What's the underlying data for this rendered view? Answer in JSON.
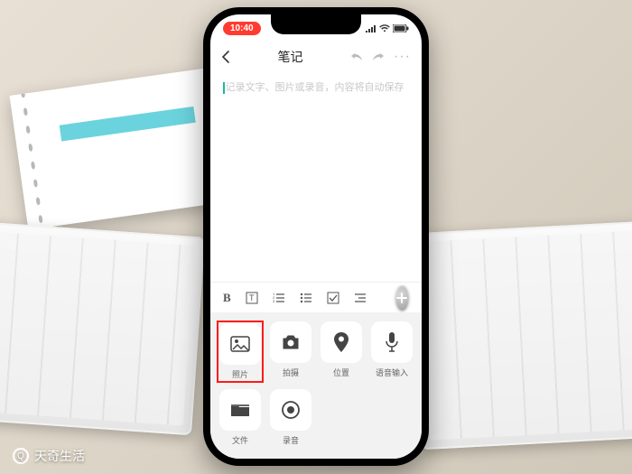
{
  "status": {
    "time": "10:40",
    "signal_icon": "signal-icon",
    "wifi_icon": "wifi-icon",
    "battery_icon": "battery-icon"
  },
  "nav": {
    "back_icon": "chevron-left-icon",
    "title": "笔记",
    "undo_icon": "undo-icon",
    "redo_icon": "redo-icon",
    "more_icon": "more-icon"
  },
  "editor": {
    "placeholder": "记录文字、图片或录音，内容将自动保存"
  },
  "toolbar": {
    "bold": "B",
    "textstyle_icon": "text-style-icon",
    "list_ordered_icon": "ordered-list-icon",
    "list_bullet_icon": "bullet-list-icon",
    "checklist_icon": "checklist-icon",
    "more_format_icon": "indent-icon",
    "add_icon": "plus-icon"
  },
  "attachments": {
    "items": [
      {
        "label": "照片",
        "icon": "image-icon",
        "highlight": true
      },
      {
        "label": "拍摄",
        "icon": "camera-icon"
      },
      {
        "label": "位置",
        "icon": "location-icon"
      },
      {
        "label": "语音输入",
        "icon": "mic-icon"
      },
      {
        "label": "文件",
        "icon": "folder-icon"
      },
      {
        "label": "录音",
        "icon": "record-icon"
      }
    ]
  },
  "watermark": {
    "text": "天奇生活"
  }
}
